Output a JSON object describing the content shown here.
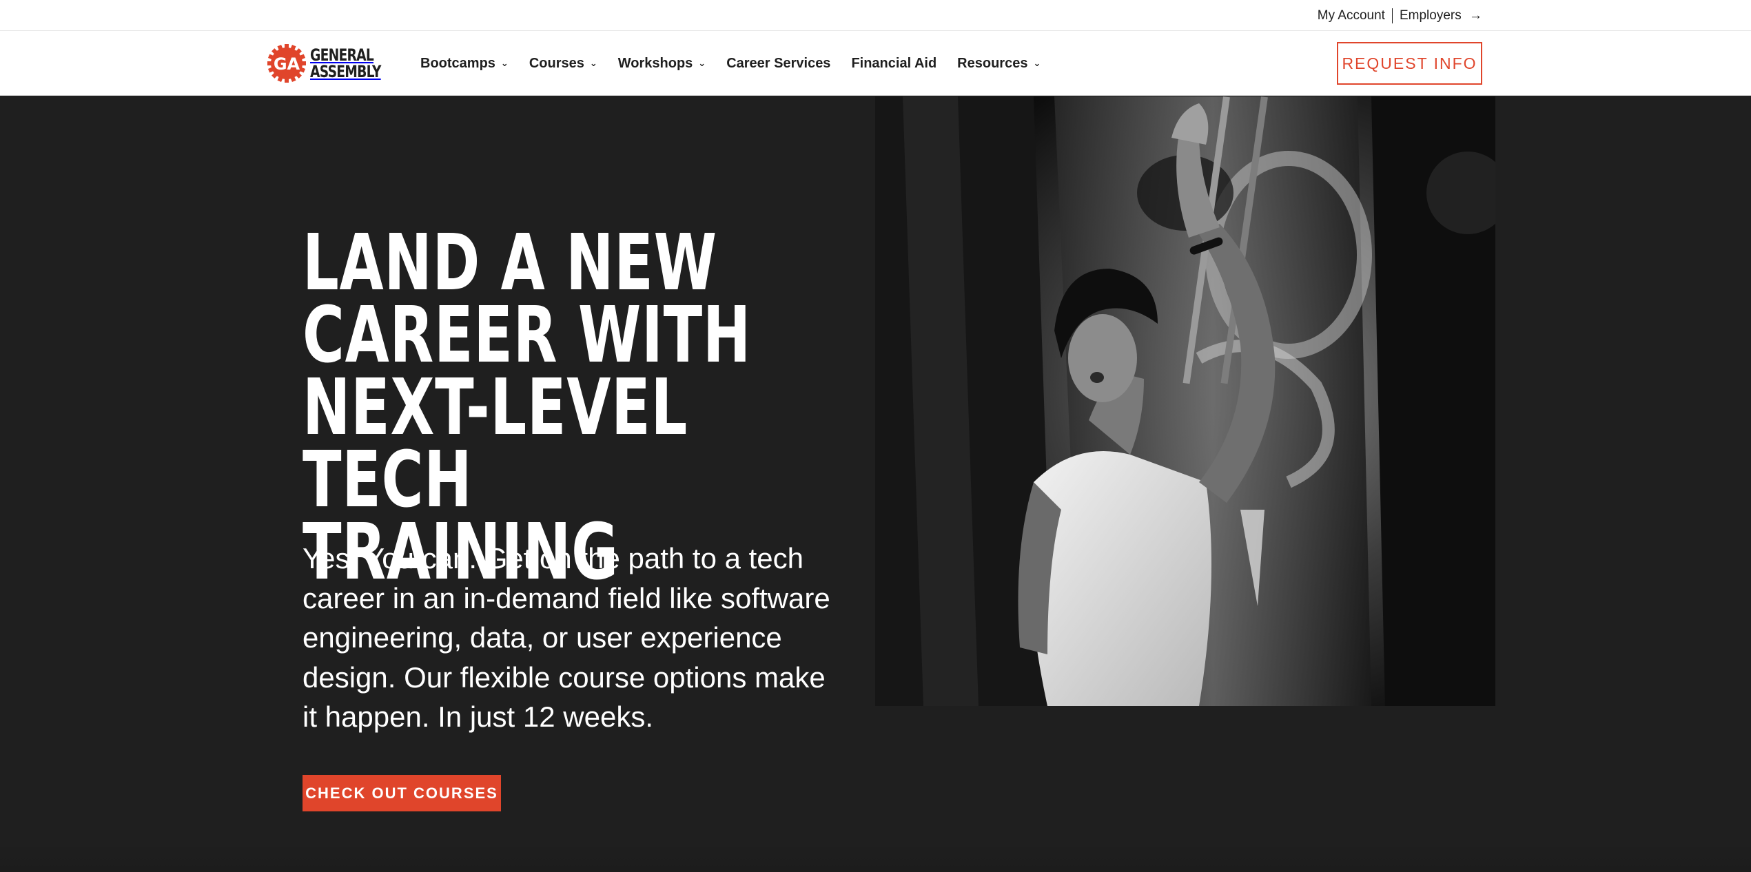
{
  "utility": {
    "my_account": "My Account",
    "employers": "Employers",
    "employers_arrow": "→"
  },
  "logo": {
    "badge_text": "GA",
    "line1": "GENERAL",
    "line2": "ASSEMBLY"
  },
  "nav": {
    "items": [
      {
        "label": "Bootcamps",
        "dropdown": true
      },
      {
        "label": "Courses",
        "dropdown": true
      },
      {
        "label": "Workshops",
        "dropdown": true
      },
      {
        "label": "Career Services",
        "dropdown": false
      },
      {
        "label": "Financial Aid",
        "dropdown": false
      },
      {
        "label": "Resources",
        "dropdown": true
      }
    ],
    "chevron_glyph": "⌄",
    "request_info": "REQUEST INFO"
  },
  "hero": {
    "title_lines": [
      "LAND A NEW",
      "CAREER WITH",
      "NEXT-LEVEL TECH",
      "TRAINING"
    ],
    "subtitle": "Yes. You can. Get on the path to a tech career in an in-demand field like software engineering, data, or user experience design. Our flexible course options make it happen. In just 12 weeks.",
    "cta": "CHECK OUT COURSES"
  },
  "colors": {
    "accent": "#e0452b",
    "background": "#1f1f1f",
    "text_light": "#ffffff",
    "text_dark": "#1f1f1f"
  },
  "icons": {
    "employers_arrow": "arrow-right-icon",
    "nav_dropdown": "chevron-down-icon",
    "logo": "ga-gear-logo-icon"
  }
}
